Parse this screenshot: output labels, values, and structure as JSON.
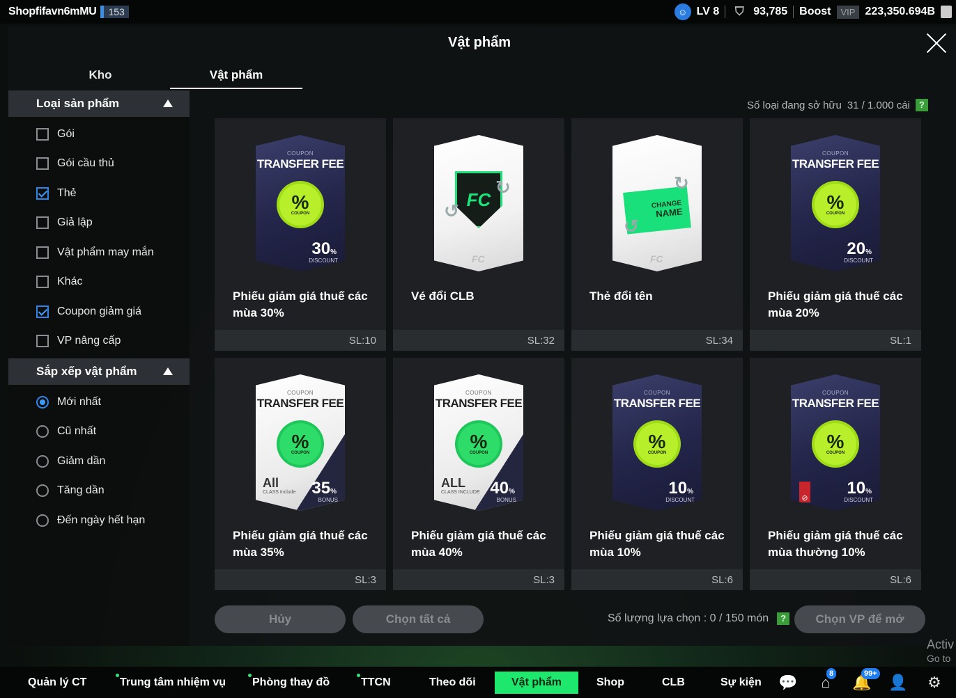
{
  "topbar": {
    "username": "Shopfifavn6mMU",
    "user_badge": "153",
    "level": "LV 8",
    "points": "93,785",
    "boost_label": "Boost",
    "vip_label": "VIP",
    "coins": "223,350.694B"
  },
  "window": {
    "title": "Vật phẩm"
  },
  "tabs": [
    {
      "label": "Kho",
      "active": false
    },
    {
      "label": "Vật phẩm",
      "active": true
    }
  ],
  "filter": {
    "product_title": "Loại sản phẩm",
    "product_options": [
      {
        "label": "Gói",
        "checked": false
      },
      {
        "label": "Gói cầu thủ",
        "checked": false
      },
      {
        "label": "Thẻ",
        "checked": true
      },
      {
        "label": "Giả lập",
        "checked": false
      },
      {
        "label": "Vật phẩm may mắn",
        "checked": false
      },
      {
        "label": "Khác",
        "checked": false
      },
      {
        "label": "Coupon giảm giá",
        "checked": true
      },
      {
        "label": "VP nâng cấp",
        "checked": false
      }
    ],
    "sort_title": "Sắp xếp vật phẩm",
    "sort_options": [
      {
        "label": "Mới nhất",
        "checked": true
      },
      {
        "label": "Cũ nhất",
        "checked": false
      },
      {
        "label": "Giảm dần",
        "checked": false
      },
      {
        "label": "Tăng dần",
        "checked": false
      },
      {
        "label": "Đến ngày hết hạn",
        "checked": false
      }
    ]
  },
  "owned": {
    "label": "Số loại đang sở hữu",
    "value": "31 / 1.000 cái",
    "help": "?"
  },
  "items": [
    {
      "name": "Phiếu giảm giá thuế các mùa 30%",
      "qty": "SL:10",
      "type": "coupon-dark",
      "coupon_small": "COUPON",
      "coupon_title": "TRANSFER FEE",
      "seal": "%",
      "seal_text": "COUPON",
      "value": "30",
      "unit": "%",
      "sub": "DISCOUNT"
    },
    {
      "name": "Vé đổi CLB",
      "qty": "SL:32",
      "type": "club"
    },
    {
      "name": "Thẻ đổi tên",
      "qty": "SL:34",
      "type": "rename",
      "tag_line1": "CHANGE",
      "tag_line2": "NAME"
    },
    {
      "name": "Phiếu giảm giá thuế các mùa 20%",
      "qty": "SL:1",
      "type": "coupon-dark",
      "coupon_small": "COUPON",
      "coupon_title": "TRANSFER FEE",
      "seal": "%",
      "seal_text": "COUPON",
      "value": "20",
      "unit": "%",
      "sub": "DISCOUNT"
    },
    {
      "name": "Phiếu giảm giá thuế các mùa 35%",
      "qty": "SL:3",
      "type": "coupon-light",
      "coupon_small": "COUPON",
      "coupon_title": "TRANSFER FEE",
      "seal": "%",
      "seal_text": "COUPON",
      "value": "35",
      "unit": "%",
      "sub": "BONUS",
      "all": "All",
      "all_sub": "CLASS Include"
    },
    {
      "name": "Phiếu giảm giá thuế các mùa 40%",
      "qty": "SL:3",
      "type": "coupon-light",
      "coupon_small": "COUPON",
      "coupon_title": "TRANSFER FEE",
      "seal": "%",
      "seal_text": "COUPON",
      "value": "40",
      "unit": "%",
      "sub": "BONUS",
      "all": "ALL",
      "all_sub": "CLASS INCLUDE"
    },
    {
      "name": "Phiếu giảm giá thuế các mùa 10%",
      "qty": "SL:6",
      "type": "coupon-dark",
      "coupon_small": "COUPON",
      "coupon_title": "TRANSFER FEE",
      "seal": "%",
      "seal_text": "COUPON",
      "value": "10",
      "unit": "%",
      "sub": "DISCOUNT"
    },
    {
      "name": "Phiếu giảm giá thuế các mùa thường 10%",
      "qty": "SL:6",
      "type": "coupon-dark-ban",
      "coupon_small": "COUPON",
      "coupon_title": "TRANSFER FEE",
      "seal": "%",
      "seal_text": "COUPON",
      "value": "10",
      "unit": "%",
      "sub": "DISCOUNT"
    }
  ],
  "actions": {
    "cancel": "Hủy",
    "select_all": "Chọn tất cả",
    "selection_label": "Số lượng lựa chọn : 0 / 150 món",
    "help": "?",
    "open": "Chọn VP để mở"
  },
  "watermark": {
    "line1": "Activ",
    "line2": "Go to"
  },
  "nav": {
    "items": [
      "Quản lý CT",
      "Trung tâm nhiệm vụ",
      "Phòng thay đồ",
      "TTCN",
      "Theo dõi",
      "Vật phẩm",
      "Shop",
      "CLB",
      "Sự kiện"
    ],
    "badge_home": "8",
    "badge_bell": "99+"
  }
}
